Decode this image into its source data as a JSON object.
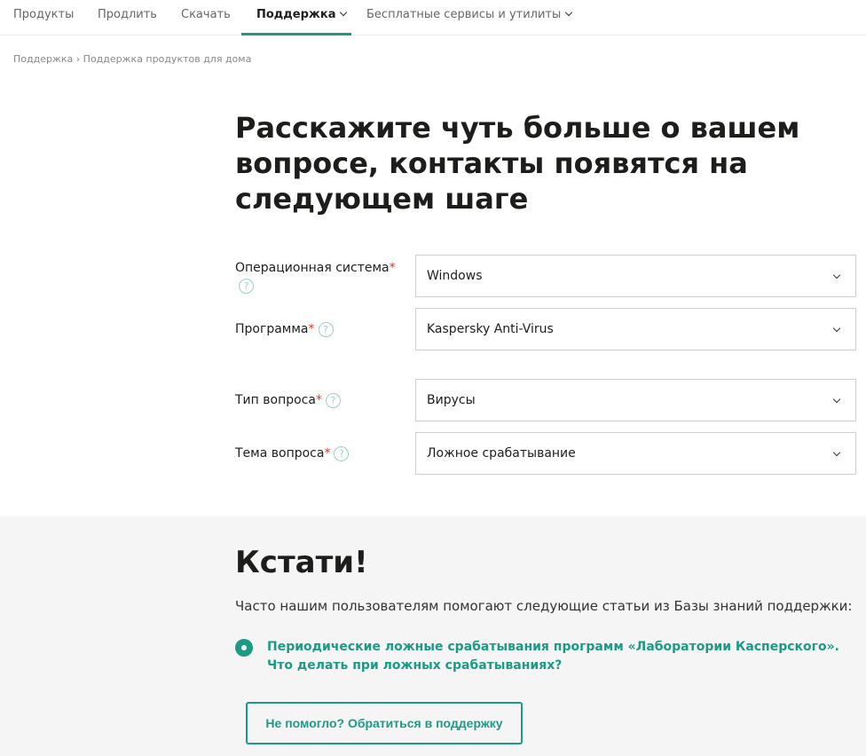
{
  "nav": {
    "items": [
      "Продукты",
      "Продлить",
      "Скачать",
      "Поддержка",
      "Бесплатные сервисы и утилиты"
    ]
  },
  "breadcrumb": [
    "Поддержка",
    "Поддержка продуктов для дома"
  ],
  "title": "Расскажите чуть больше о вашем вопросе, контакты появятся на следующем шаге",
  "form": [
    {
      "label": "Операционная система",
      "value": "Windows"
    },
    {
      "label": "Программа",
      "value": "Kaspersky Anti-Virus"
    },
    {
      "label": "Тип вопроса",
      "value": "Вирусы"
    },
    {
      "label": "Тема вопроса",
      "value": "Ложное срабатывание"
    }
  ],
  "required_mark": "*",
  "help_glyph": "?",
  "tips": {
    "title": "Кстати!",
    "subtitle": "Часто нашим пользователям помогают следующие статьи из Базы знаний поддержки:",
    "article": "Периодические ложные срабатывания программ «Лаборатории Касперского». Что делать при ложных срабатываниях?",
    "button": "Не помогло? Обратиться в поддержку"
  },
  "colors": {
    "accent": "#1d9a86",
    "required": "#e0352b"
  }
}
